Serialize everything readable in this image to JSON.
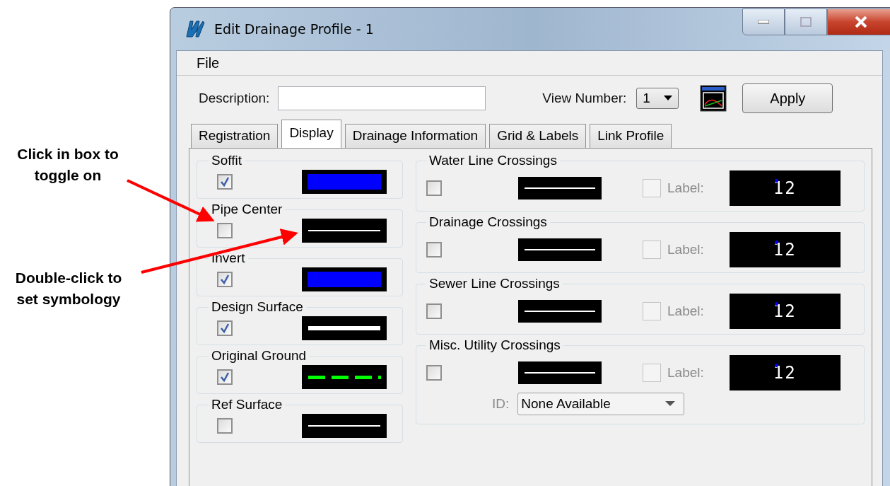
{
  "annotations": [
    {
      "text": "Click in box to toggle on"
    },
    {
      "text": "Double-click to set symbology"
    }
  ],
  "window": {
    "title": "Edit Drainage Profile - 1"
  },
  "menu": [
    "File"
  ],
  "description": {
    "label": "Description:"
  },
  "view_number": {
    "label": "View Number:",
    "value": "1"
  },
  "apply_button": "Apply",
  "tabs": [
    {
      "label": "Registration",
      "selected": false
    },
    {
      "label": "Display",
      "selected": true
    },
    {
      "label": "Drainage Information",
      "selected": false
    },
    {
      "label": "Grid & Labels",
      "selected": false
    },
    {
      "label": "Link Profile",
      "selected": false
    }
  ],
  "display_groups": [
    {
      "title": "Soffit",
      "checked": true,
      "kind": "fill",
      "color": "#0000ff"
    },
    {
      "title": "Pipe Center",
      "checked": false,
      "kind": "line",
      "color": "#ffffff"
    },
    {
      "title": "Invert",
      "checked": true,
      "kind": "fill",
      "color": "#0000ff"
    },
    {
      "title": "Design Surface",
      "checked": true,
      "kind": "thick",
      "color": "#ffffff"
    },
    {
      "title": "Original Ground",
      "checked": true,
      "kind": "dash",
      "color": "#00ff00"
    },
    {
      "title": "Ref Surface",
      "checked": false,
      "kind": "line",
      "color": "#ffffff"
    }
  ],
  "crossings": [
    {
      "title": "Water Line Crossings",
      "checked": false,
      "label_checked": false,
      "label_text": "Label:",
      "preview": "12"
    },
    {
      "title": "Drainage Crossings",
      "checked": false,
      "label_checked": false,
      "label_text": "Label:",
      "preview": "12"
    },
    {
      "title": "Sewer Line Crossings",
      "checked": false,
      "label_checked": false,
      "label_text": "Label:",
      "preview": "12"
    },
    {
      "title": "Misc. Utility Crossings",
      "checked": false,
      "label_checked": false,
      "label_text": "Label:",
      "preview": "12",
      "id_label": "ID:",
      "id_value": "None Available"
    }
  ]
}
